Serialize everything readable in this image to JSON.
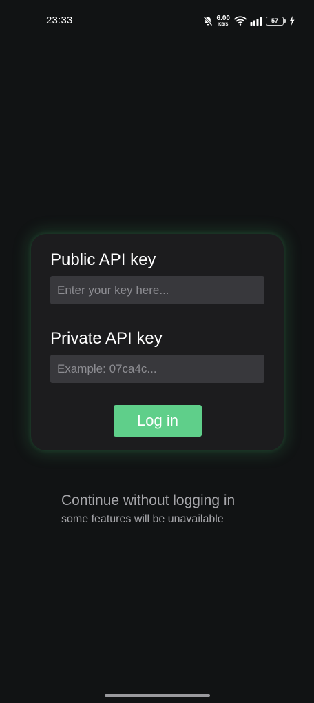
{
  "status_bar": {
    "time": "23:33",
    "net_speed_value": "6.00",
    "net_speed_unit": "KB/S",
    "battery_level": "57",
    "icons": [
      "bell-muted-icon",
      "wifi-icon",
      "signal-icon",
      "battery-icon",
      "charging-bolt-icon"
    ]
  },
  "login_card": {
    "public_label": "Public API key",
    "public_placeholder": "Enter your key here...",
    "private_label": "Private API key",
    "private_placeholder": "Example: 07ca4c...",
    "login_button_label": "Log in"
  },
  "continue_option": {
    "title": "Continue without logging in",
    "subtitle": "some features will be unavailable"
  },
  "colors": {
    "background": "#111314",
    "card": "#1c1c1e",
    "input": "#38383c",
    "accent": "#5fcf8a",
    "muted_text": "#a6a6aa"
  }
}
